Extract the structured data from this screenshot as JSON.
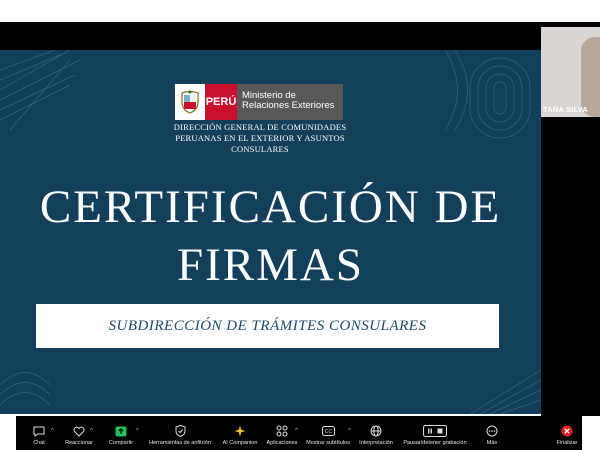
{
  "slide": {
    "logo": {
      "country": "PERÚ",
      "ministry_line1": "Ministerio de",
      "ministry_line2": "Relaciones Exteriores"
    },
    "org_line1": "DIRECCIÓN GENERAL DE COMUNIDADES",
    "org_line2": "PERUANAS EN EL EXTERIOR Y ASUNTOS",
    "org_line3": "CONSULARES",
    "title_line1": "CERTIFICACIÓN DE",
    "title_line2": "FIRMAS",
    "subtitle": "SUBDIRECCIÓN DE TRÁMITES CONSULARES",
    "background_color": "#133f5a"
  },
  "participant": {
    "name": "TAÑA SILVA"
  },
  "toolbar": {
    "chat": "Chat",
    "reactions": "Reaccionar",
    "share": "Compartir",
    "host_tools": "Herramientas de anfitrión",
    "ai_companion": "AI Companion",
    "apps": "Aplicaciones",
    "captions": "Mostrar subtítulos",
    "interpretation": "Interpretación",
    "pause_recording": "Pausar/detener grabación",
    "more": "Más",
    "end": "Finalizar",
    "share_color": "#22c55e",
    "end_color": "#e02020"
  }
}
